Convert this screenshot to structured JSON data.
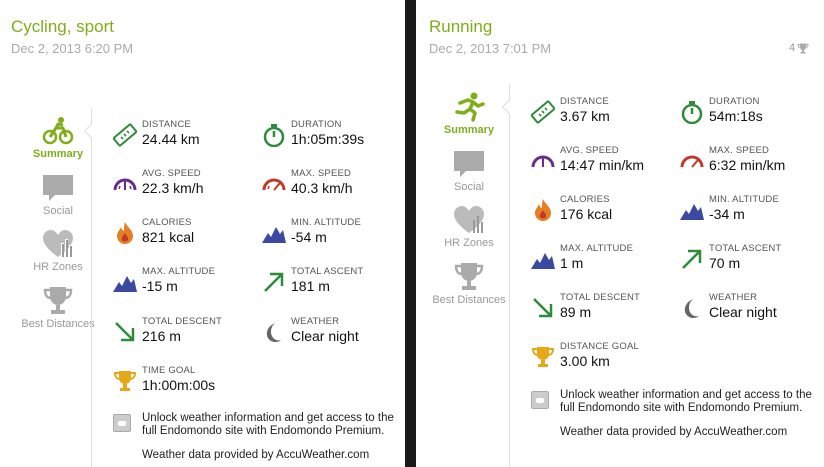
{
  "left": {
    "title": "Cycling, sport",
    "date": "Dec 2, 2013 6:20 PM",
    "nav": [
      {
        "label": "Summary"
      },
      {
        "label": "Social"
      },
      {
        "label": "HR Zones"
      },
      {
        "label": "Best Distances"
      }
    ],
    "stats": [
      {
        "label": "DISTANCE",
        "value": "24.44 km",
        "icon": "ruler-icon"
      },
      {
        "label": "DURATION",
        "value": "1h:05m:39s",
        "icon": "stopwatch-icon"
      },
      {
        "label": "AVG. SPEED",
        "value": "22.3 km/h",
        "icon": "speedometer-icon"
      },
      {
        "label": "MAX. SPEED",
        "value": "40.3 km/h",
        "icon": "speedometer-icon"
      },
      {
        "label": "CALORIES",
        "value": "821 kcal",
        "icon": "flame-icon"
      },
      {
        "label": "MIN. ALTITUDE",
        "value": "-54 m",
        "icon": "mountain-icon"
      },
      {
        "label": "MAX. ALTITUDE",
        "value": "-15 m",
        "icon": "mountain-icon"
      },
      {
        "label": "TOTAL ASCENT",
        "value": "181 m",
        "icon": "arrow-up-right-icon"
      },
      {
        "label": "TOTAL DESCENT",
        "value": "216 m",
        "icon": "arrow-down-right-icon"
      },
      {
        "label": "WEATHER",
        "value": "Clear night",
        "icon": "moon-icon"
      },
      {
        "label": "TIME GOAL",
        "value": "1h:00m:00s",
        "icon": "trophy-icon"
      }
    ],
    "promo": {
      "text": "Unlock weather information and get access to the full Endomondo site with Endomondo Premium.",
      "credit": "Weather data provided by AccuWeather.com"
    }
  },
  "right": {
    "title": "Running",
    "date": "Dec 2, 2013 7:01 PM",
    "likes": "4",
    "nav": [
      {
        "label": "Summary"
      },
      {
        "label": "Social"
      },
      {
        "label": "HR Zones"
      },
      {
        "label": "Best Distances"
      }
    ],
    "stats": [
      {
        "label": "DISTANCE",
        "value": "3.67 km",
        "icon": "ruler-icon"
      },
      {
        "label": "DURATION",
        "value": "54m:18s",
        "icon": "stopwatch-icon"
      },
      {
        "label": "AVG. SPEED",
        "value": "14:47 min/km",
        "icon": "speedometer-icon"
      },
      {
        "label": "MAX. SPEED",
        "value": "6:32 min/km",
        "icon": "speedometer-icon"
      },
      {
        "label": "CALORIES",
        "value": "176 kcal",
        "icon": "flame-icon"
      },
      {
        "label": "MIN. ALTITUDE",
        "value": "-34 m",
        "icon": "mountain-icon"
      },
      {
        "label": "MAX. ALTITUDE",
        "value": "1 m",
        "icon": "mountain-icon"
      },
      {
        "label": "TOTAL ASCENT",
        "value": "70 m",
        "icon": "arrow-up-right-icon"
      },
      {
        "label": "TOTAL DESCENT",
        "value": "89 m",
        "icon": "arrow-down-right-icon"
      },
      {
        "label": "WEATHER",
        "value": "Clear night",
        "icon": "moon-icon"
      },
      {
        "label": "DISTANCE GOAL",
        "value": "3.00 km",
        "icon": "trophy-icon"
      }
    ],
    "promo": {
      "text": "Unlock weather information and get access to the full Endomondo site with Endomondo Premium.",
      "credit": "Weather data provided by AccuWeather.com"
    }
  },
  "colors": {
    "accent": "#7fae1a",
    "muted": "#aaaaaa",
    "icon_green": "#2e8b3a",
    "icon_purple": "#6a2c8a",
    "icon_red": "#c0392b",
    "icon_orange": "#e67e22",
    "icon_blue": "#3b4aa0",
    "icon_gold": "#e6a817"
  }
}
